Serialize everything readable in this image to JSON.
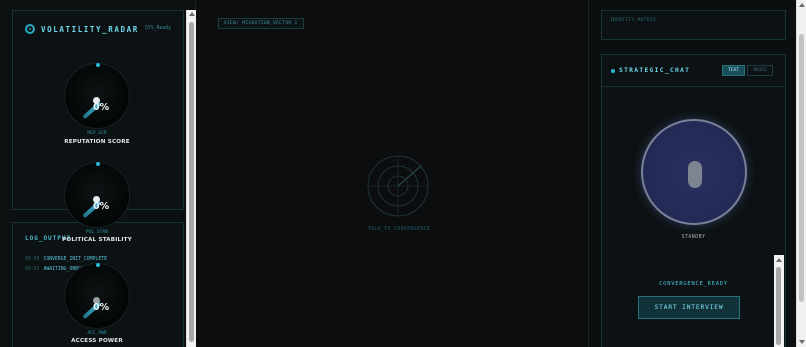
{
  "radar": {
    "title": "VOLATILITY_RADAR",
    "status": "SYS_Ready"
  },
  "gauges": [
    {
      "code": "REP_SCR",
      "label": "REPUTATION SCORE",
      "value": "0%",
      "level": 0
    },
    {
      "code": "POL_STAB",
      "label": "POLITICAL STABILITY",
      "value": "0%",
      "level": 0
    },
    {
      "code": "ACC_PWR",
      "label": "ACCESS POWER",
      "value": "0%",
      "level": 0
    }
  ],
  "log": {
    "title": "LOG_OUTPUT",
    "lines": [
      {
        "ts": "00:00",
        "msg": "CONVERGE_INIT_COMPLETE"
      },
      {
        "ts": "00:01",
        "msg": "AWAITING_ONBOARDING..."
      }
    ]
  },
  "view": {
    "label": "VIEW: MIGRATION_VECTOR_1"
  },
  "center": {
    "caption": "TALK_TO_CONVERGENCE"
  },
  "identity": {
    "label": "IDENTITY_MATRIX"
  },
  "chat": {
    "title": "STRATEGIC_CHAT",
    "modes": [
      "TEXT",
      "VOICE"
    ],
    "active_mode": "TEXT",
    "mic_state": "STANDBY",
    "ready_text": "CONVERGENCE_READY",
    "start_label": "START INTERVIEW"
  },
  "colors": {
    "accent": "#2ab6da",
    "background": "#0b0d0e",
    "orb": "#262c5a"
  },
  "icons": {
    "radar_logo": "radar-logo-icon",
    "mic": "microphone-icon",
    "center": "radar-sweep-icon"
  }
}
